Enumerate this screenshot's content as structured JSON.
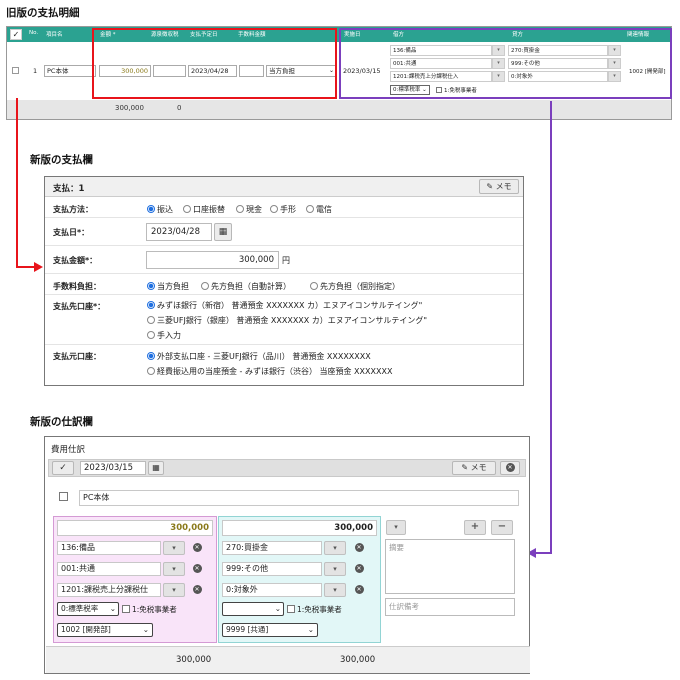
{
  "titles": {
    "old": "旧版の支払明細",
    "pay": "新版の支払欄",
    "journal": "新版の仕訳欄"
  },
  "old_table": {
    "headers": {
      "check": "✓",
      "no": "No.",
      "item": "項目名",
      "amount": "金額 *",
      "withholding": "源泉徴収税",
      "due_date": "支払予定日",
      "fee": "手数料金額",
      "exec_date": "実施日",
      "debit": "借方",
      "credit": "貸方",
      "related": "関連情報"
    },
    "row": {
      "no": "1",
      "item": "PC本体",
      "amount": "300,000",
      "due_date": "2023/04/28",
      "fee_select": "当方負担",
      "exec_date": "2023/03/15",
      "debit_lines": [
        "136:備品",
        "001:共通",
        "1201:課税売上分課税仕入"
      ],
      "credit_lines": [
        "270:買掛金",
        "999:その他",
        "0:対象外"
      ],
      "tax_select": "0:標準税率",
      "exempt_label": "1:免税事業者",
      "related": "1002 [開発部]"
    },
    "footer": {
      "amount": "300,000",
      "withholding": "0"
    }
  },
  "payment": {
    "title": "支払：1",
    "memo_label": "メモ",
    "method_label": "支払方法：",
    "methods": [
      "振込",
      "口座振替",
      "現金",
      "手形",
      "電信"
    ],
    "selected_method": "振込",
    "date_label": "支払日*：",
    "date_value": "2023/04/28",
    "amount_label": "支払金額*：",
    "amount_value": "300,000",
    "amount_unit": "円",
    "fee_label": "手数料負担：",
    "fee_options": [
      "当方負担",
      "先方負担（自動計算）",
      "先方負担（個別指定）"
    ],
    "selected_fee": "当方負担",
    "dest_label": "支払先口座*：",
    "dest_options": [
      "みずほ銀行（新宿） 普通預金 XXXXXXX カ）エヌアイコンサルテイング\"",
      "三菱UFJ銀行（銀座） 普通預金 XXXXXXX カ）エヌアイコンサルテイング\"",
      "手入力"
    ],
    "src_label": "支払元口座：",
    "src_options": [
      "外部支払口座 - 三菱UFJ銀行（品川） 普通預金 XXXXXXXX",
      "経費振込用の当座預金 - みずほ銀行（渋谷） 当座預金 XXXXXXX"
    ]
  },
  "journal": {
    "title": "費用仕訳",
    "date_value": "2023/03/15",
    "memo_label": "メモ",
    "item_name": "PC本体",
    "debit": {
      "amount": "300,000",
      "account": "136:備品",
      "dept": "001:共通",
      "tax": "1201:課税売上分課税仕",
      "tax_rate": "0:標準税率",
      "exempt_label": "1:免税事業者",
      "related": "1002 [開発部]"
    },
    "credit": {
      "amount": "300,000",
      "account": "270:買掛金",
      "dept": "999:その他",
      "tax": "0:対象外",
      "tax_rate": "",
      "exempt_label": "1:免税事業者",
      "related": "9999 [共通]"
    },
    "summary_placeholder": "摘要",
    "remarks_placeholder": "仕訳備考",
    "footer": {
      "debit_total": "300,000",
      "credit_total": "300,000"
    }
  },
  "colors": {
    "header_green": "#2ba291",
    "highlight_red": "#e8141b",
    "highlight_purple": "#7b3fbd",
    "debit_bg": "#f9e4f9",
    "credit_bg": "#e2f7f7",
    "amount_text": "#8a7a1a"
  }
}
